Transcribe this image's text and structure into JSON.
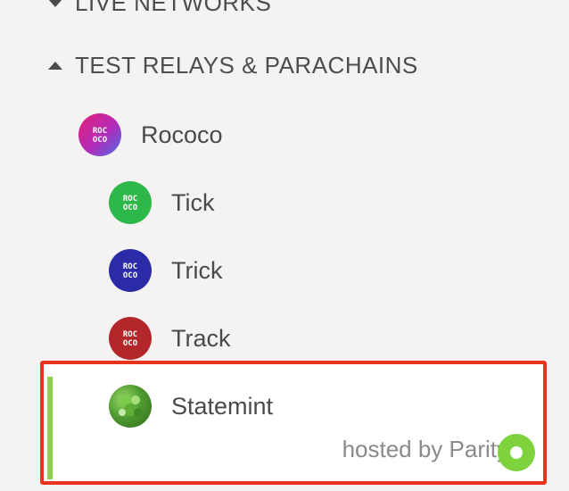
{
  "sections": {
    "live": {
      "label": "LIVE NETWORKS"
    },
    "test": {
      "label": "TEST RELAYS & PARACHAINS"
    }
  },
  "networks": [
    {
      "label": "Rococo",
      "logo_text": [
        "ROC",
        "OCO"
      ],
      "color": "#d6237a"
    },
    {
      "label": "Tick",
      "logo_text": [
        "ROC",
        "OCO"
      ],
      "color": "#2fb84a"
    },
    {
      "label": "Trick",
      "logo_text": [
        "ROC",
        "OCO"
      ],
      "color": "#2b2ba8"
    },
    {
      "label": "Track",
      "logo_text": [
        "ROC",
        "OCO"
      ],
      "color": "#b3262a"
    },
    {
      "label": "Statemint",
      "icon": "leaf-icon",
      "color": "#4a9a34"
    }
  ],
  "selected": {
    "provider": "hosted by Parity",
    "status_color": "#7ed23b",
    "outline_color": "#e8341f"
  }
}
